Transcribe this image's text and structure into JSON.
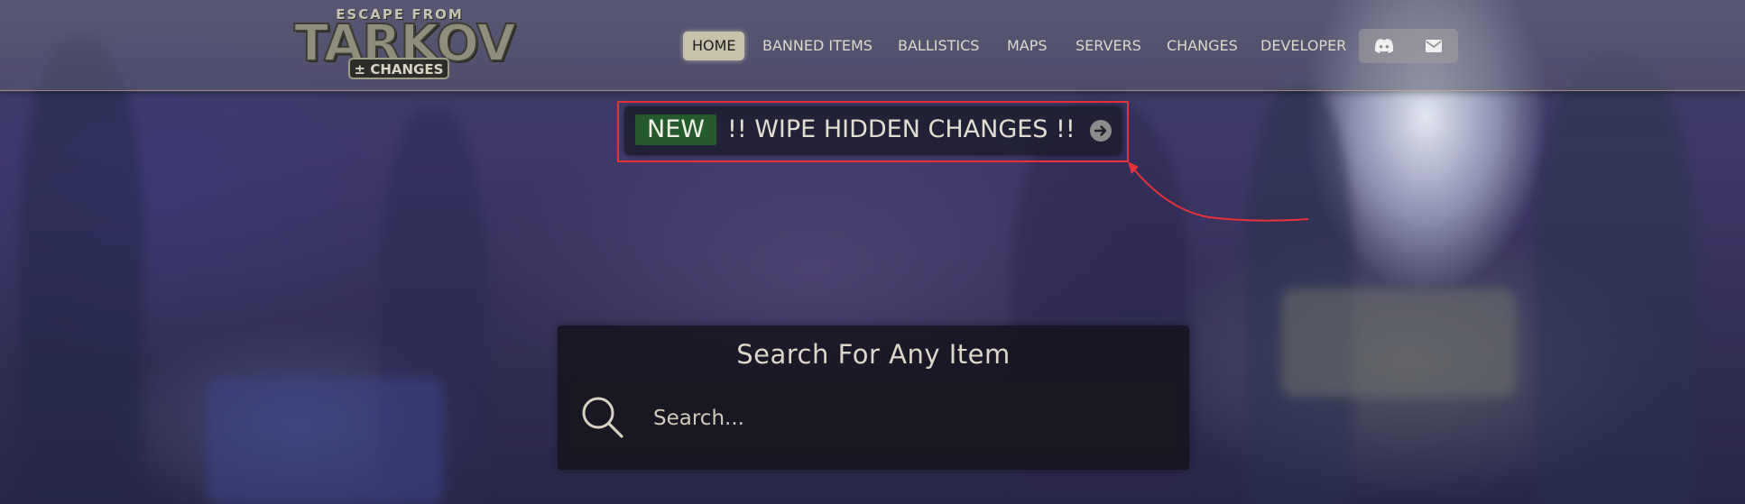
{
  "logo": {
    "top_text": "ESCAPE FROM",
    "main_text": "TARKOV",
    "badge_text": "± CHANGES"
  },
  "nav": {
    "items": [
      {
        "label": "HOME",
        "active": true
      },
      {
        "label": "BANNED ITEMS",
        "active": false
      },
      {
        "label": "BALLISTICS",
        "active": false
      },
      {
        "label": "MAPS",
        "active": false
      },
      {
        "label": "SERVERS",
        "active": false
      },
      {
        "label": "CHANGES",
        "active": false
      },
      {
        "label": "DEVELOPER",
        "active": false
      }
    ],
    "social": [
      {
        "icon": "discord-icon"
      },
      {
        "icon": "envelope-icon"
      }
    ]
  },
  "announcement": {
    "badge": "NEW",
    "text": "!! WIPE HIDDEN CHANGES !!",
    "icon": "arrow-right-circle-icon",
    "highlight_color": "#e8323c"
  },
  "search": {
    "title": "Search For Any Item",
    "placeholder": "Search...",
    "value": ""
  },
  "colors": {
    "new_badge": "#245a2c",
    "active_nav": "#c8c2ab",
    "text_light": "#ddd8cc"
  }
}
